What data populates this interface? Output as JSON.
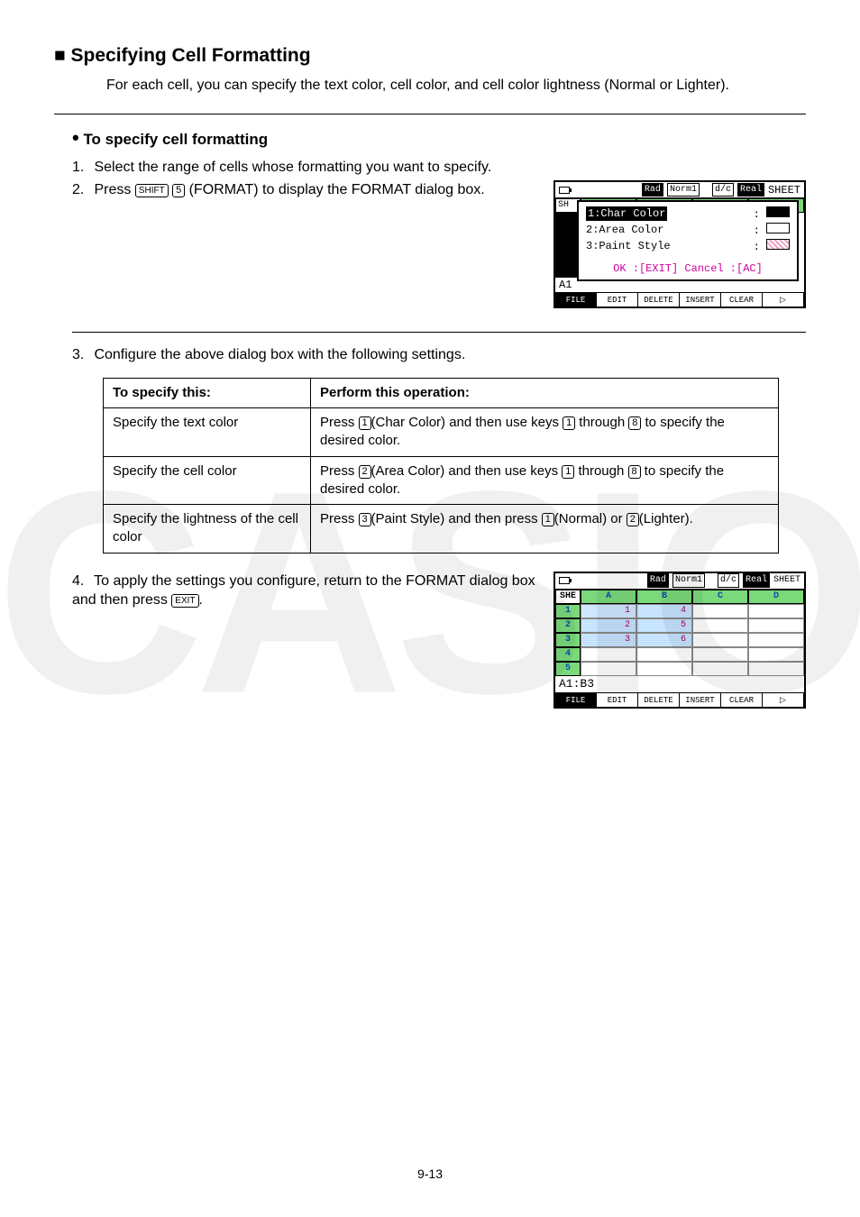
{
  "section": {
    "title_prefix": "■",
    "title": "Specifying Cell Formatting",
    "intro": "For each cell, you can specify the text color, cell color, and cell color lightness (Normal or Lighter)."
  },
  "sub": {
    "bullet": "•",
    "title": "To specify cell formatting"
  },
  "steps": {
    "s1_num": "1.",
    "s1": "Select the range of cells whose formatting you want to specify.",
    "s2_num": "2.",
    "s2a": "Press ",
    "s2_key1": "SHIFT",
    "s2_key2": "5",
    "s2b": "(FORMAT) to display the FORMAT dialog box.",
    "s3_num": "3.",
    "s3": "Configure the above dialog box with the following settings.",
    "s4_num": "4.",
    "s4a": "To apply the settings you configure, return to the FORMAT dialog box and then press ",
    "s4_key": "EXIT",
    "s4b": "."
  },
  "dialog1": {
    "rad": "Rad",
    "norm": "Norm1",
    "dc": "d/c",
    "real": "Real",
    "sheet": "SHEET",
    "she": "SH",
    "line1": "1:Char Color",
    "line2": "2:Area Color",
    "line3": "3:Paint Style",
    "a1": "A1",
    "ok": "OK :[EXIT]  Cancel :[AC]",
    "fn1": "FILE",
    "fn2": "EDIT",
    "fn3": "DELETE",
    "fn4": "INSERT",
    "fn5": "CLEAR"
  },
  "table": {
    "h1": "To specify this:",
    "h2": "Perform this operation:",
    "r1c1": "Specify the text color",
    "r1c2a": "Press ",
    "r1c2b": "(Char Color) and then use keys ",
    "r1c2c": " through ",
    "r1c2d": " to specify the desired color.",
    "r2c1": "Specify the cell color",
    "r2c2a": "Press ",
    "r2c2b": "(Area Color) and then use keys ",
    "r2c2c": " through ",
    "r2c2d": " to specify the desired color.",
    "r3c1": "Specify the lightness of the cell color",
    "r3c2a": "Press ",
    "r3c2b": "(Paint Style) and then press ",
    "r3c2c": "(Normal) or ",
    "r3c2d": "(Lighter).",
    "k1": "1",
    "k2": "2",
    "k3": "3",
    "k8": "8"
  },
  "dialog2": {
    "rad": "Rad",
    "norm": "Norm1",
    "dc": "d/c",
    "real": "Real",
    "sheet": "SHEET",
    "she": "SHE",
    "colA": "A",
    "colB": "B",
    "colC": "C",
    "colD": "D",
    "rows": [
      "1",
      "2",
      "3",
      "4",
      "5"
    ],
    "dataA": [
      "1",
      "2",
      "3",
      "",
      ""
    ],
    "dataB": [
      "4",
      "5",
      "6",
      "",
      ""
    ],
    "addr": "A1:B3",
    "fn1": "FILE",
    "fn2": "EDIT",
    "fn3": "DELETE",
    "fn4": "INSERT",
    "fn5": "CLEAR"
  },
  "chart_data": {
    "type": "table",
    "title": "Spreadsheet SHEET (A1:B3 selected)",
    "columns": [
      "A",
      "B",
      "C",
      "D"
    ],
    "rows": [
      {
        "row": 1,
        "A": 1,
        "B": 4,
        "C": null,
        "D": null
      },
      {
        "row": 2,
        "A": 2,
        "B": 5,
        "C": null,
        "D": null
      },
      {
        "row": 3,
        "A": 3,
        "B": 6,
        "C": null,
        "D": null
      },
      {
        "row": 4,
        "A": null,
        "B": null,
        "C": null,
        "D": null
      },
      {
        "row": 5,
        "A": null,
        "B": null,
        "C": null,
        "D": null
      }
    ],
    "selection": "A1:B3"
  },
  "page_number": "9-13",
  "watermark": "CASIO"
}
